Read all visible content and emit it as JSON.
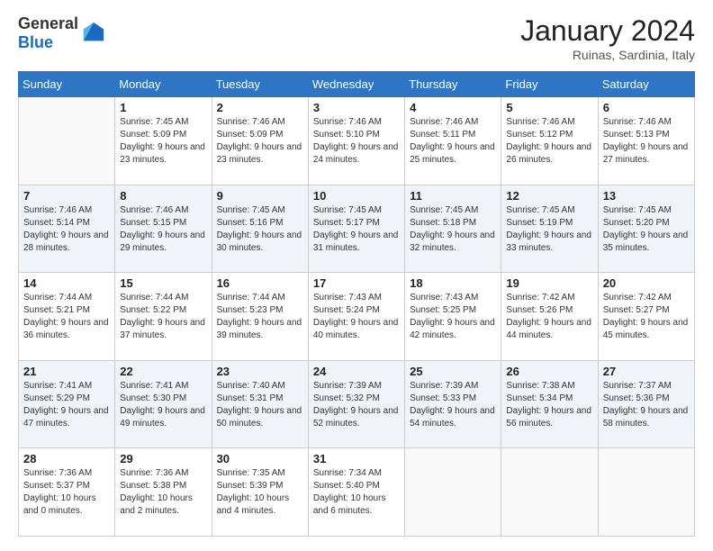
{
  "header": {
    "logo_general": "General",
    "logo_blue": "Blue",
    "month_title": "January 2024",
    "subtitle": "Ruinas, Sardinia, Italy"
  },
  "weekdays": [
    "Sunday",
    "Monday",
    "Tuesday",
    "Wednesday",
    "Thursday",
    "Friday",
    "Saturday"
  ],
  "weeks": [
    [
      {
        "day": "",
        "sunrise": "",
        "sunset": "",
        "daylight": ""
      },
      {
        "day": "1",
        "sunrise": "Sunrise: 7:45 AM",
        "sunset": "Sunset: 5:09 PM",
        "daylight": "Daylight: 9 hours and 23 minutes."
      },
      {
        "day": "2",
        "sunrise": "Sunrise: 7:46 AM",
        "sunset": "Sunset: 5:09 PM",
        "daylight": "Daylight: 9 hours and 23 minutes."
      },
      {
        "day": "3",
        "sunrise": "Sunrise: 7:46 AM",
        "sunset": "Sunset: 5:10 PM",
        "daylight": "Daylight: 9 hours and 24 minutes."
      },
      {
        "day": "4",
        "sunrise": "Sunrise: 7:46 AM",
        "sunset": "Sunset: 5:11 PM",
        "daylight": "Daylight: 9 hours and 25 minutes."
      },
      {
        "day": "5",
        "sunrise": "Sunrise: 7:46 AM",
        "sunset": "Sunset: 5:12 PM",
        "daylight": "Daylight: 9 hours and 26 minutes."
      },
      {
        "day": "6",
        "sunrise": "Sunrise: 7:46 AM",
        "sunset": "Sunset: 5:13 PM",
        "daylight": "Daylight: 9 hours and 27 minutes."
      }
    ],
    [
      {
        "day": "7",
        "sunrise": "Sunrise: 7:46 AM",
        "sunset": "Sunset: 5:14 PM",
        "daylight": "Daylight: 9 hours and 28 minutes."
      },
      {
        "day": "8",
        "sunrise": "Sunrise: 7:46 AM",
        "sunset": "Sunset: 5:15 PM",
        "daylight": "Daylight: 9 hours and 29 minutes."
      },
      {
        "day": "9",
        "sunrise": "Sunrise: 7:45 AM",
        "sunset": "Sunset: 5:16 PM",
        "daylight": "Daylight: 9 hours and 30 minutes."
      },
      {
        "day": "10",
        "sunrise": "Sunrise: 7:45 AM",
        "sunset": "Sunset: 5:17 PM",
        "daylight": "Daylight: 9 hours and 31 minutes."
      },
      {
        "day": "11",
        "sunrise": "Sunrise: 7:45 AM",
        "sunset": "Sunset: 5:18 PM",
        "daylight": "Daylight: 9 hours and 32 minutes."
      },
      {
        "day": "12",
        "sunrise": "Sunrise: 7:45 AM",
        "sunset": "Sunset: 5:19 PM",
        "daylight": "Daylight: 9 hours and 33 minutes."
      },
      {
        "day": "13",
        "sunrise": "Sunrise: 7:45 AM",
        "sunset": "Sunset: 5:20 PM",
        "daylight": "Daylight: 9 hours and 35 minutes."
      }
    ],
    [
      {
        "day": "14",
        "sunrise": "Sunrise: 7:44 AM",
        "sunset": "Sunset: 5:21 PM",
        "daylight": "Daylight: 9 hours and 36 minutes."
      },
      {
        "day": "15",
        "sunrise": "Sunrise: 7:44 AM",
        "sunset": "Sunset: 5:22 PM",
        "daylight": "Daylight: 9 hours and 37 minutes."
      },
      {
        "day": "16",
        "sunrise": "Sunrise: 7:44 AM",
        "sunset": "Sunset: 5:23 PM",
        "daylight": "Daylight: 9 hours and 39 minutes."
      },
      {
        "day": "17",
        "sunrise": "Sunrise: 7:43 AM",
        "sunset": "Sunset: 5:24 PM",
        "daylight": "Daylight: 9 hours and 40 minutes."
      },
      {
        "day": "18",
        "sunrise": "Sunrise: 7:43 AM",
        "sunset": "Sunset: 5:25 PM",
        "daylight": "Daylight: 9 hours and 42 minutes."
      },
      {
        "day": "19",
        "sunrise": "Sunrise: 7:42 AM",
        "sunset": "Sunset: 5:26 PM",
        "daylight": "Daylight: 9 hours and 44 minutes."
      },
      {
        "day": "20",
        "sunrise": "Sunrise: 7:42 AM",
        "sunset": "Sunset: 5:27 PM",
        "daylight": "Daylight: 9 hours and 45 minutes."
      }
    ],
    [
      {
        "day": "21",
        "sunrise": "Sunrise: 7:41 AM",
        "sunset": "Sunset: 5:29 PM",
        "daylight": "Daylight: 9 hours and 47 minutes."
      },
      {
        "day": "22",
        "sunrise": "Sunrise: 7:41 AM",
        "sunset": "Sunset: 5:30 PM",
        "daylight": "Daylight: 9 hours and 49 minutes."
      },
      {
        "day": "23",
        "sunrise": "Sunrise: 7:40 AM",
        "sunset": "Sunset: 5:31 PM",
        "daylight": "Daylight: 9 hours and 50 minutes."
      },
      {
        "day": "24",
        "sunrise": "Sunrise: 7:39 AM",
        "sunset": "Sunset: 5:32 PM",
        "daylight": "Daylight: 9 hours and 52 minutes."
      },
      {
        "day": "25",
        "sunrise": "Sunrise: 7:39 AM",
        "sunset": "Sunset: 5:33 PM",
        "daylight": "Daylight: 9 hours and 54 minutes."
      },
      {
        "day": "26",
        "sunrise": "Sunrise: 7:38 AM",
        "sunset": "Sunset: 5:34 PM",
        "daylight": "Daylight: 9 hours and 56 minutes."
      },
      {
        "day": "27",
        "sunrise": "Sunrise: 7:37 AM",
        "sunset": "Sunset: 5:36 PM",
        "daylight": "Daylight: 9 hours and 58 minutes."
      }
    ],
    [
      {
        "day": "28",
        "sunrise": "Sunrise: 7:36 AM",
        "sunset": "Sunset: 5:37 PM",
        "daylight": "Daylight: 10 hours and 0 minutes."
      },
      {
        "day": "29",
        "sunrise": "Sunrise: 7:36 AM",
        "sunset": "Sunset: 5:38 PM",
        "daylight": "Daylight: 10 hours and 2 minutes."
      },
      {
        "day": "30",
        "sunrise": "Sunrise: 7:35 AM",
        "sunset": "Sunset: 5:39 PM",
        "daylight": "Daylight: 10 hours and 4 minutes."
      },
      {
        "day": "31",
        "sunrise": "Sunrise: 7:34 AM",
        "sunset": "Sunset: 5:40 PM",
        "daylight": "Daylight: 10 hours and 6 minutes."
      },
      {
        "day": "",
        "sunrise": "",
        "sunset": "",
        "daylight": ""
      },
      {
        "day": "",
        "sunrise": "",
        "sunset": "",
        "daylight": ""
      },
      {
        "day": "",
        "sunrise": "",
        "sunset": "",
        "daylight": ""
      }
    ]
  ]
}
